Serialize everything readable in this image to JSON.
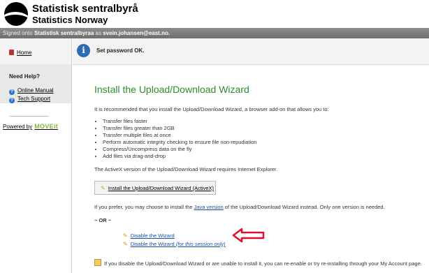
{
  "header": {
    "org_name": "Statistisk sentralbyrå",
    "org_name_en": "Statistics Norway"
  },
  "signed": {
    "prefix": "Signed onto",
    "org": "Statistisk sentralbyraa",
    "as": "as",
    "email": "svein.johansen@east.no."
  },
  "sidebar": {
    "home": "Home",
    "need_help": "Need Help?",
    "online_manual": "Online Manual",
    "tech_support": "Tech Support",
    "powered_by": "Powered by",
    "mover": "MOVEit"
  },
  "status": {
    "message": "Set password OK."
  },
  "main": {
    "title": "Install the Upload/Download Wizard",
    "intro": "It is recommended that you install the Upload/Download Wizard, a browser add-on that allows you to:",
    "features": [
      "Transfer files faster",
      "Transfer files greater than 2GB",
      "Transfer multiple files at once",
      "Perform automatic integrity checking to ensure file non-repudiation",
      "Compress/Uncompress data on the fly",
      "Add files via drag-and-drop"
    ],
    "activex_note": "The ActiveX version of the Upload/Download Wizard requires Internet Explorer.",
    "install_button": "Install the Upload/Download Wizard (ActiveX)",
    "java_prefix": "If you prefer, you may choose to install the",
    "java_link": "Java version",
    "java_suffix": "of the Upload/Download Wizard instead. Only one version is needed.",
    "or": "~ OR ~",
    "disable": "Disable the Wizard",
    "disable_session": "Disable the Wizard",
    "disable_session_note": "(for this session only)",
    "footer": "If you disable the Upload/Download Wizard or are unable to install it, you can re-enable or try re-installing through your My Account page."
  },
  "colors": {
    "title_green": "#2e8b2e",
    "link_blue": "#1a4fa0",
    "arrow_red": "#e0102a"
  }
}
